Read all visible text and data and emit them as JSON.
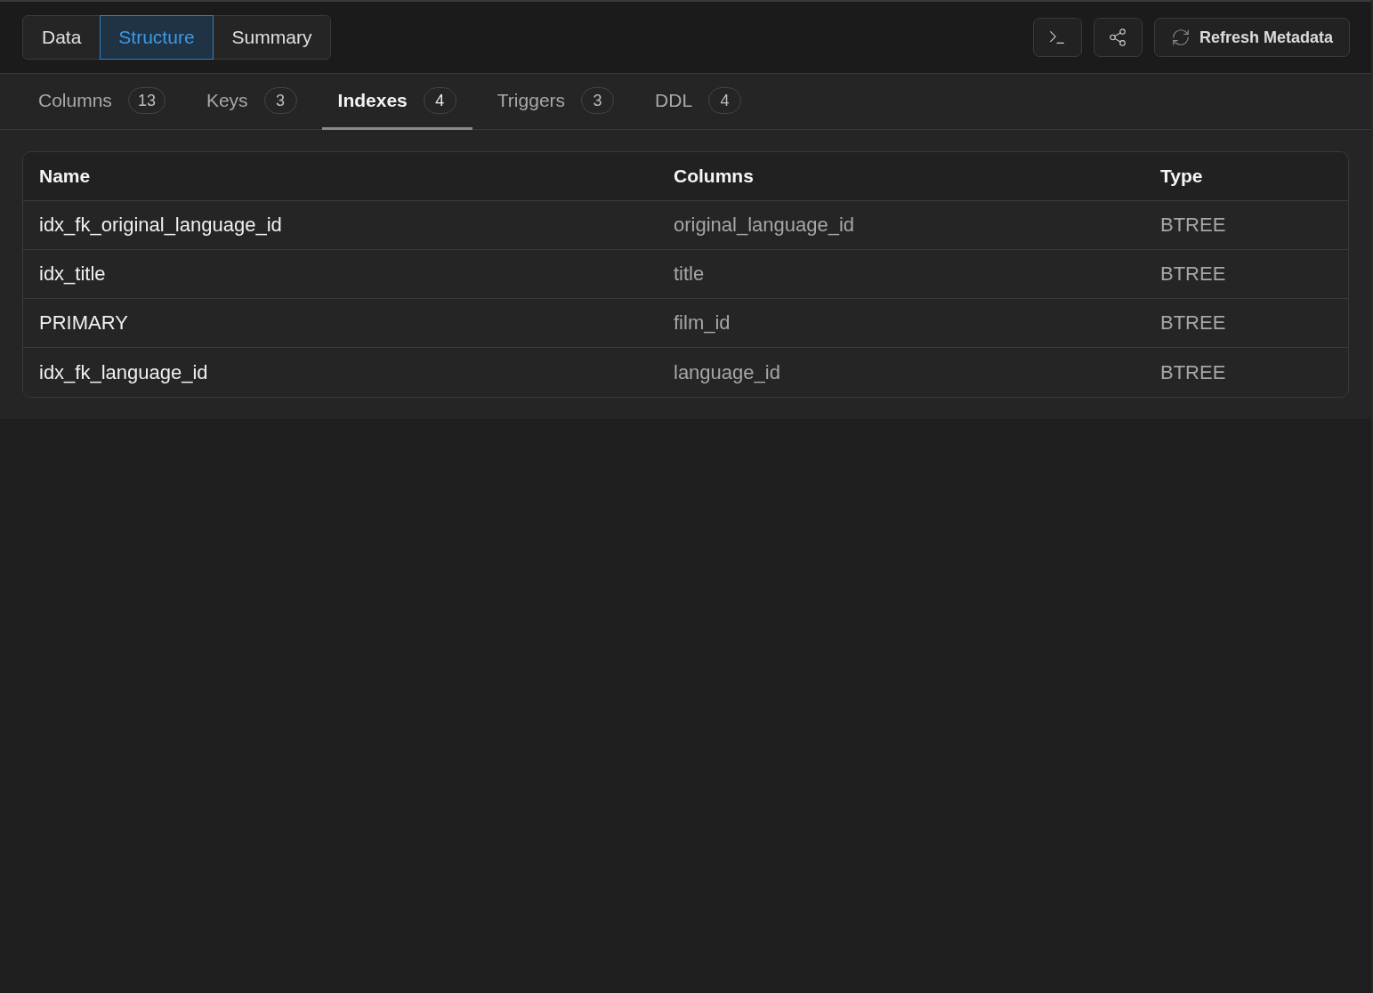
{
  "view_switcher": [
    {
      "label": "Data",
      "selected": false
    },
    {
      "label": "Structure",
      "selected": true
    },
    {
      "label": "Summary",
      "selected": false
    }
  ],
  "toolbar": [
    {
      "kind": "terminal"
    },
    {
      "kind": "share"
    },
    {
      "kind": "refresh",
      "label": "Refresh Metadata"
    }
  ],
  "tabs": [
    {
      "label": "Columns",
      "count": "13",
      "selected": false
    },
    {
      "label": "Keys",
      "count": "3",
      "selected": false
    },
    {
      "label": "Indexes",
      "count": "4",
      "selected": true
    },
    {
      "label": "Triggers",
      "count": "3",
      "selected": false
    },
    {
      "label": "DDL",
      "count": "4",
      "selected": false
    }
  ],
  "table": {
    "columns": [
      "Name",
      "Columns",
      "Type"
    ],
    "rows": [
      [
        "idx_fk_original_language_id",
        "original_language_id",
        "BTREE"
      ],
      [
        "idx_title",
        "title",
        "BTREE"
      ],
      [
        "PRIMARY",
        "film_id",
        "BTREE"
      ],
      [
        "idx_fk_language_id",
        "language_id",
        "BTREE"
      ]
    ]
  }
}
